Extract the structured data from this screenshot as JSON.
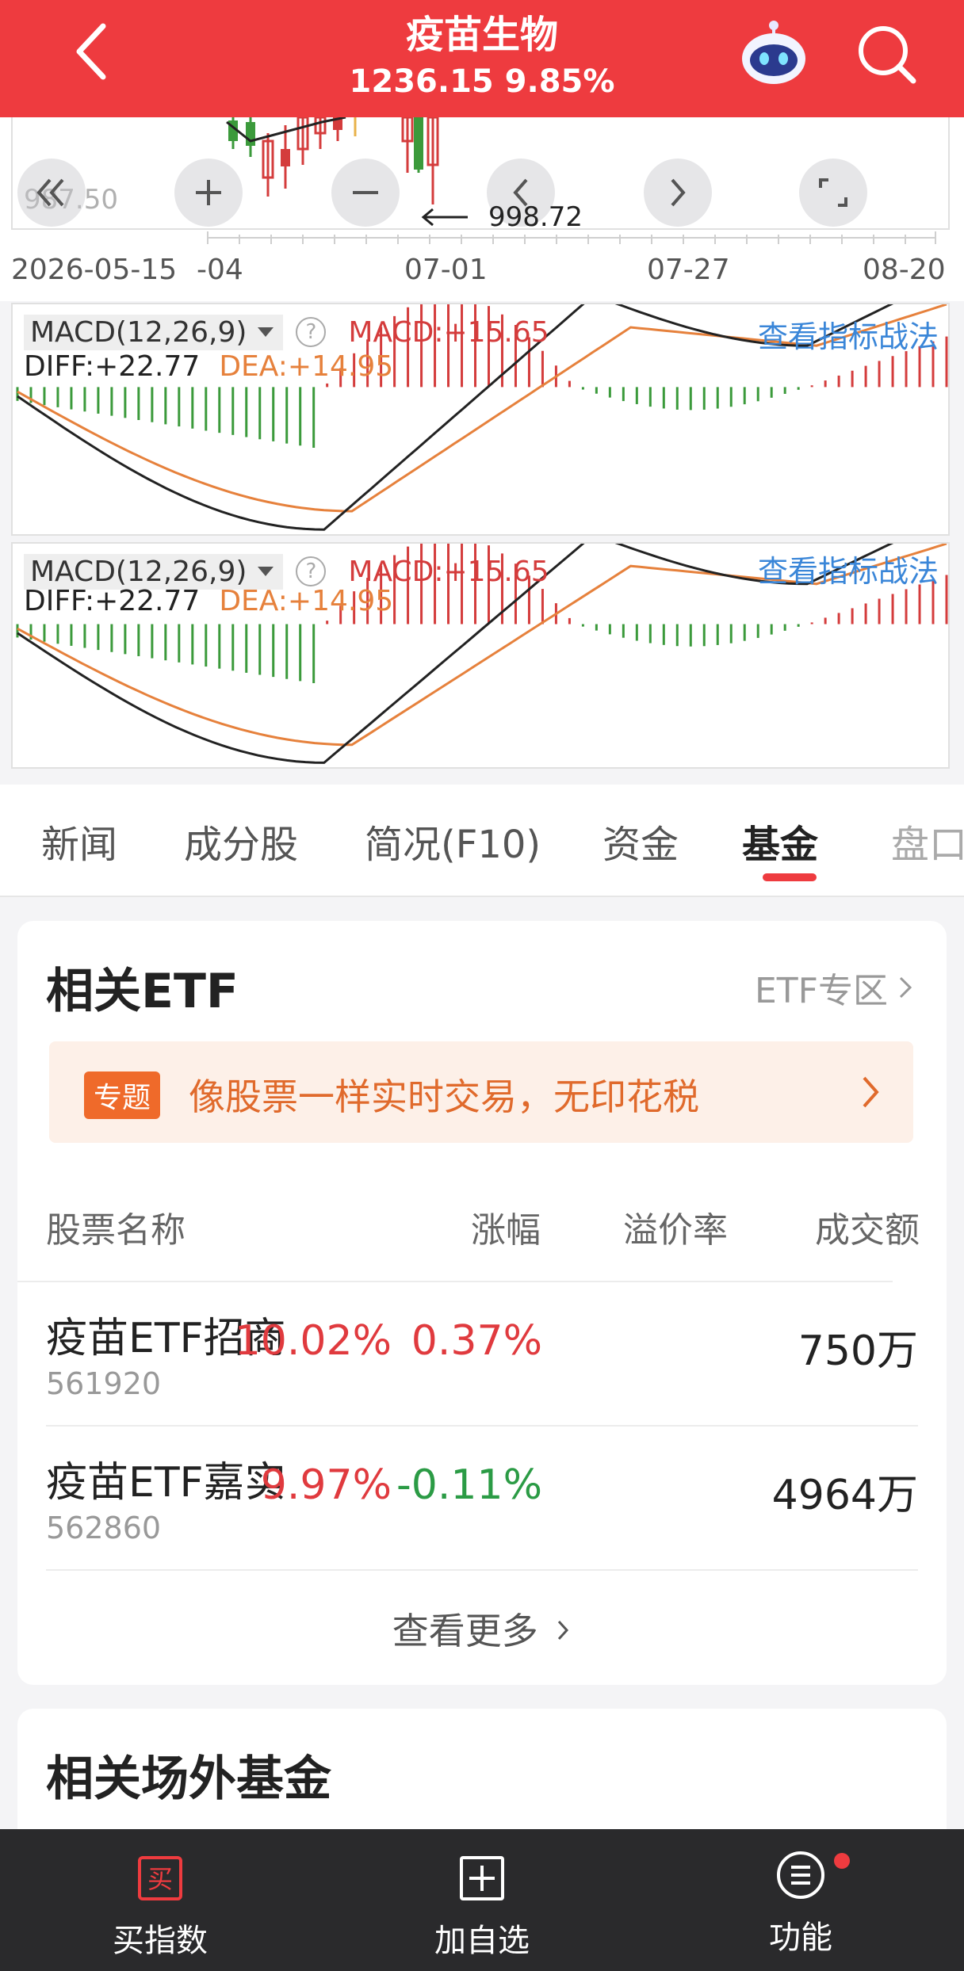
{
  "header": {
    "title": "疫苗生物",
    "price_line": "1236.15 9.85%"
  },
  "chart": {
    "low_label": "987.50",
    "min_label": "998.72",
    "dates": [
      "2026-05-15",
      "-04",
      "07-01",
      "07-27",
      "08-20"
    ],
    "macd_panels": [
      {
        "selector": "MACD(12,26,9)",
        "macd": "MACD:+15.65",
        "diff": "DIFF:+22.77",
        "dea": "DEA:+14.95",
        "link": "查看指标战法"
      },
      {
        "selector": "MACD(12,26,9)",
        "macd": "MACD:+15.65",
        "diff": "DIFF:+22.77",
        "dea": "DEA:+14.95",
        "link": "查看指标战法"
      }
    ],
    "colors": {
      "up": "#d43c3c",
      "down": "#3b9a3b",
      "diff_line": "#222222",
      "dea_line": "#e6813c"
    }
  },
  "tabs": [
    {
      "label": "新闻"
    },
    {
      "label": "成分股"
    },
    {
      "label": "简况(F10)"
    },
    {
      "label": "资金"
    },
    {
      "label": "基金"
    },
    {
      "label": "盘口"
    }
  ],
  "etf": {
    "title": "相关ETF",
    "zone_link": "ETF专区",
    "banner_badge": "专题",
    "banner_text": "像股票一样实时交易，无印花税",
    "columns": [
      "股票名称",
      "涨幅",
      "溢价率",
      "成交额"
    ],
    "rows": [
      {
        "name": "疫苗ETF招商",
        "code": "561920",
        "change": "10.02%",
        "premium": "0.37%",
        "turnover": "750万"
      },
      {
        "name": "疫苗ETF嘉实",
        "code": "562860",
        "change": "9.97%",
        "premium": "-0.11%",
        "turnover": "4964万"
      }
    ],
    "more": "查看更多"
  },
  "otc": {
    "title": "相关场外基金"
  },
  "bottom_bar": {
    "buy_icon_text": "买",
    "buy_label": "买指数",
    "add_label": "加自选",
    "func_label": "功能"
  }
}
